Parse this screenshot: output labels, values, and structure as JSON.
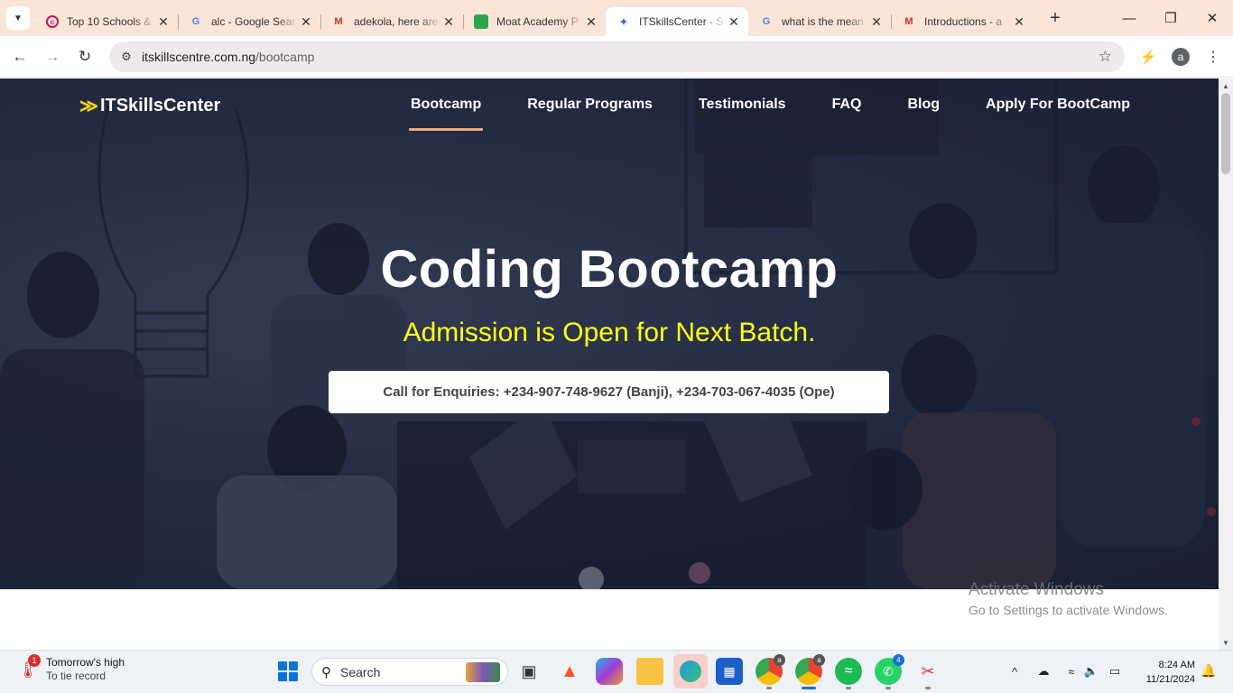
{
  "browser": {
    "tabs": [
      {
        "title": "Top 10 Schools & ",
        "favicon": "circle-c-icon",
        "favicon_color": "#c2185b",
        "active": false
      },
      {
        "title": "alc - Google Sear",
        "favicon": "google-icon",
        "favicon_color": "#4285f4",
        "active": false
      },
      {
        "title": "adekola, here are",
        "favicon": "gmail-icon",
        "favicon_color": "#d93025",
        "active": false
      },
      {
        "title": "Moat Academy P",
        "favicon": "moat-icon",
        "favicon_color": "#2ea44f",
        "active": false
      },
      {
        "title": "ITSkillsCenter - S",
        "favicon": "itskills-icon",
        "favicon_color": "#1a73e8",
        "active": true
      },
      {
        "title": "what is the mean",
        "favicon": "google-icon",
        "favicon_color": "#4285f4",
        "active": false
      },
      {
        "title": "Introductions - a",
        "favicon": "gmail-icon",
        "favicon_color": "#d93025",
        "active": false
      }
    ],
    "url_host": "itskillscentre.com.ng",
    "url_path": "/bootcamp",
    "profile_initial": "a"
  },
  "site": {
    "logo_text": "ITSkillsCenter",
    "nav": [
      {
        "label": "Bootcamp",
        "current": true
      },
      {
        "label": "Regular Programs",
        "current": false
      },
      {
        "label": "Testimonials",
        "current": false
      },
      {
        "label": "FAQ",
        "current": false
      },
      {
        "label": "Blog",
        "current": false
      },
      {
        "label": "Apply For BootCamp",
        "current": false
      }
    ],
    "hero_title": "Coding Bootcamp",
    "hero_subtitle": "Admission is Open for Next Batch.",
    "cta": "Call for Enquiries: +234-907-748-9627 (Banji), +234-703-067-4035 (Ope)",
    "accent_color": "#ffff14",
    "underline_color": "#e7a988"
  },
  "watermark": {
    "line1": "Activate Windows",
    "line2": "Go to Settings to activate Windows."
  },
  "taskbar": {
    "weather_badge": "1",
    "weather_title": "Tomorrow's high",
    "weather_sub": "To tie record",
    "search_label": "Search",
    "chrome_profile_badge": "a",
    "whatsapp_badge": "4",
    "time": "8:24 AM",
    "date": "11/21/2024"
  }
}
